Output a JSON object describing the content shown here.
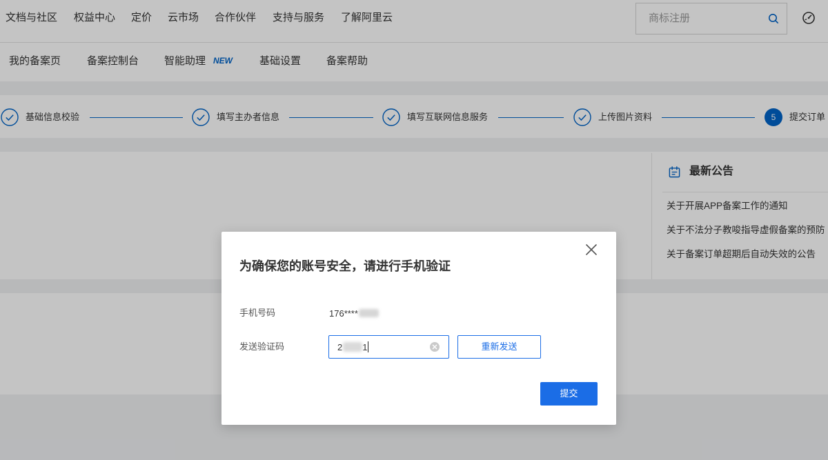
{
  "top_nav": {
    "items": [
      "文档与社区",
      "权益中心",
      "定价",
      "云市场",
      "合作伙伴",
      "支持与服务",
      "了解阿里云"
    ],
    "search_placeholder": "商标注册",
    "search_icon": "search-icon",
    "right_icon": "speedometer-icon"
  },
  "sub_nav": {
    "items": [
      "我的备案页",
      "备案控制台",
      "智能助理",
      "基础设置",
      "备案帮助"
    ],
    "badge": "NEW"
  },
  "steps": [
    {
      "label": "基础信息校验",
      "icon": "check-icon"
    },
    {
      "label": "填写主办者信息",
      "icon": "check-icon"
    },
    {
      "label": "填写互联网信息服务",
      "icon": "check-icon"
    },
    {
      "label": "上传图片资料",
      "icon": "check-icon"
    },
    {
      "label": "提交订单",
      "number": "5"
    }
  ],
  "announcements": {
    "icon": "calendar-icon",
    "title": "最新公告",
    "items": [
      "关于开展APP备案工作的通知",
      "关于不法分子教唆指导虚假备案的预防",
      "关于备案订单超期后自动失效的公告"
    ]
  },
  "modal": {
    "title": "为确保您的账号安全，请进行手机验证",
    "phone_label": "手机号码",
    "phone_value": "176****",
    "code_label": "发送验证码",
    "code_value_start": "2",
    "code_value_end": "1",
    "resend_label": "重新发送",
    "submit_label": "提交",
    "close_icon": "close-icon",
    "clear_icon": "clear-icon"
  },
  "colors": {
    "primary": "#1b6de6",
    "brand_blue": "#0064c8",
    "mask": "rgba(0,0,0,0.23)"
  }
}
